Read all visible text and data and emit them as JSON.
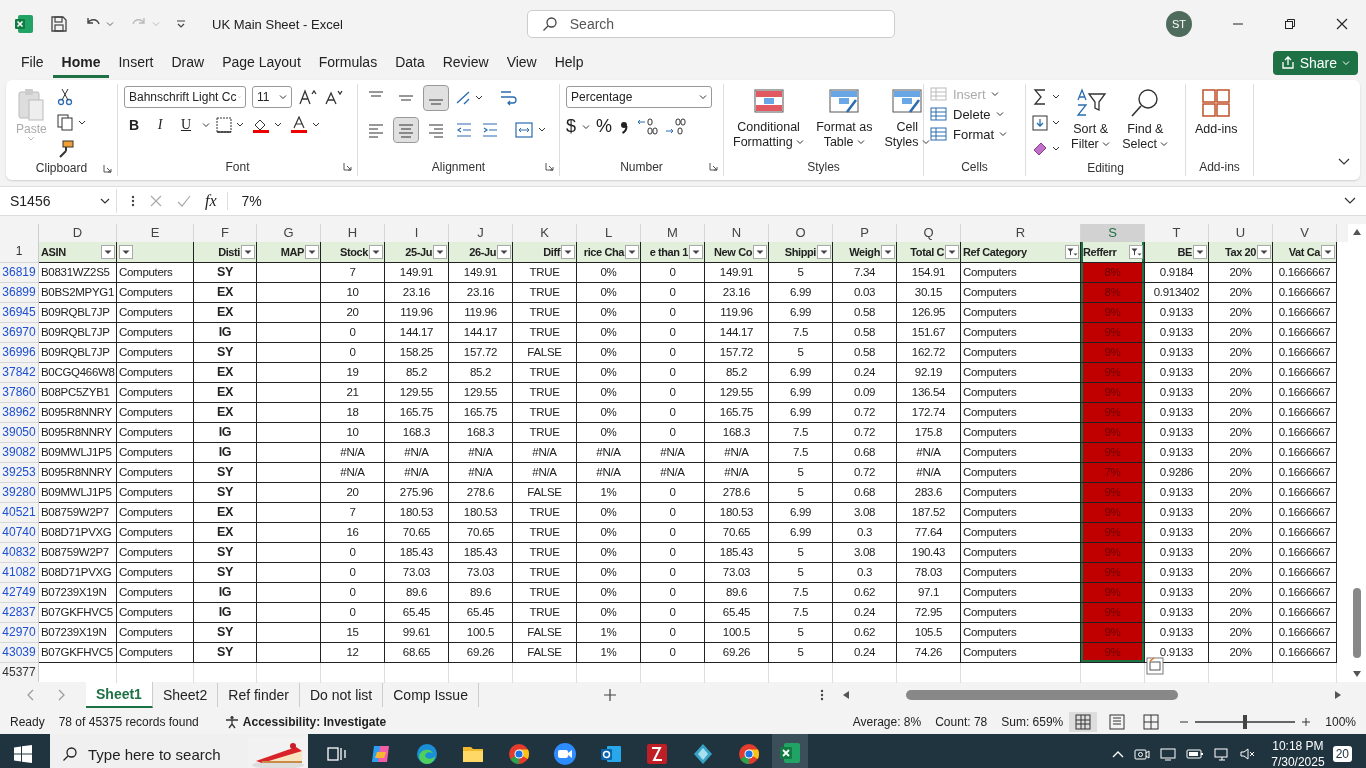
{
  "titlebar": {
    "file_name": "UK Main Sheet - Excel",
    "search_placeholder": "Search",
    "user_initials": "ST"
  },
  "menu": [
    {
      "label": "File",
      "selected": false
    },
    {
      "label": "Home",
      "selected": true
    },
    {
      "label": "Insert",
      "selected": false
    },
    {
      "label": "Draw",
      "selected": false
    },
    {
      "label": "Page Layout",
      "selected": false
    },
    {
      "label": "Formulas",
      "selected": false
    },
    {
      "label": "Data",
      "selected": false
    },
    {
      "label": "Review",
      "selected": false
    },
    {
      "label": "View",
      "selected": false
    },
    {
      "label": "Help",
      "selected": false
    }
  ],
  "share": "Share",
  "ribbon": {
    "clipboard": {
      "paste": "Paste",
      "label": "Clipboard"
    },
    "font": {
      "family": "Bahnschrift Light Cc",
      "size": "11",
      "bold": "B",
      "italic": "I",
      "underline": "U",
      "label": "Font"
    },
    "alignment": {
      "vertical": [
        {
          "selected": false
        },
        {
          "selected": false
        },
        {
          "selected": true
        }
      ],
      "horizontal": [
        {
          "selected": false
        },
        {
          "selected": true
        },
        {
          "selected": false
        }
      ],
      "label": "Alignment"
    },
    "number": {
      "format": "Percentage",
      "currency": "$",
      "percent": "%",
      "label": "Number"
    },
    "styles": {
      "items": [
        {
          "line1": "Conditional",
          "line2": "Formatting"
        },
        {
          "line1": "Format as",
          "line2": "Table"
        },
        {
          "line1": "Cell",
          "line2": "Styles"
        }
      ],
      "label": "Styles"
    },
    "cells": {
      "items": [
        {
          "label": "Insert",
          "disabled": true
        },
        {
          "label": "Delete",
          "disabled": false
        },
        {
          "label": "Format",
          "disabled": false
        }
      ],
      "label": "Cells"
    },
    "editing": {
      "items": [
        {
          "line1": "Sort &",
          "line2": "Filter"
        },
        {
          "line1": "Find &",
          "line2": "Select"
        }
      ],
      "label": "Editing"
    },
    "addins": {
      "button": "Add-ins",
      "label": "Add-ins"
    }
  },
  "formula_bar": {
    "name_box": "S1456",
    "function_label": "fx",
    "formula": "7%"
  },
  "columns": [
    {
      "letter": "D",
      "header": "ASIN",
      "kind": "text",
      "filtered": false,
      "selected": false
    },
    {
      "letter": "E",
      "kind": "text",
      "filtered": false,
      "selected": false
    },
    {
      "letter": "F",
      "header": "Disti",
      "kind": "bold",
      "filtered": false,
      "selected": false
    },
    {
      "letter": "G",
      "header": "MAP",
      "kind": "empty",
      "filtered": false,
      "selected": false
    },
    {
      "letter": "H",
      "header": "Stock",
      "kind": "number",
      "filtered": false,
      "selected": false
    },
    {
      "letter": "I",
      "header": "25-Ju",
      "kind": "number",
      "filtered": false,
      "selected": false
    },
    {
      "letter": "J",
      "header": "26-Ju",
      "kind": "number",
      "filtered": false,
      "selected": false
    },
    {
      "letter": "K",
      "header": "Diff",
      "kind": "number",
      "filtered": false,
      "selected": false
    },
    {
      "letter": "L",
      "header": "rice Cha",
      "kind": "number",
      "filtered": false,
      "selected": false
    },
    {
      "letter": "M",
      "header": "e than 1",
      "kind": "number",
      "filtered": false,
      "selected": false
    },
    {
      "letter": "N",
      "header": "New Co",
      "kind": "number",
      "filtered": false,
      "selected": false
    },
    {
      "letter": "O",
      "header": "Shippi",
      "kind": "number",
      "filtered": false,
      "selected": false
    },
    {
      "letter": "P",
      "header": "Weigh",
      "kind": "number",
      "filtered": false,
      "selected": false
    },
    {
      "letter": "Q",
      "header": "Total C",
      "kind": "number",
      "filtered": false,
      "selected": false
    },
    {
      "letter": "R",
      "header": "Ref Category",
      "kind": "text",
      "filtered": true,
      "selected": false
    },
    {
      "letter": "S",
      "header": "Refferr",
      "kind": "highlight",
      "filtered": true,
      "selected": true
    },
    {
      "letter": "T",
      "header": "BE",
      "kind": "number",
      "filtered": false,
      "selected": false
    },
    {
      "letter": "U",
      "header": "Tax 20",
      "kind": "number",
      "filtered": false,
      "selected": false
    },
    {
      "letter": "V",
      "header": "Vat Ca",
      "kind": "number",
      "filtered": false,
      "selected": false
    }
  ],
  "header_row_number": "1",
  "rows": [
    {
      "num": "36819",
      "cells": [
        "B0831WZ2S5",
        "Computers",
        "SY",
        "7",
        "149.91",
        "149.91",
        "TRUE",
        "0%",
        "0",
        "149.91",
        "5",
        "7.34",
        "154.91",
        "Computers",
        "8%",
        "0.9184",
        "20%",
        "0.1666667"
      ]
    },
    {
      "num": "36899",
      "cells": [
        "B0BS2MPYG1",
        "Computers",
        "EX",
        "10",
        "23.16",
        "23.16",
        "TRUE",
        "0%",
        "0",
        "23.16",
        "6.99",
        "0.03",
        "30.15",
        "Computers",
        "8%",
        "0.913402",
        "20%",
        "0.1666667"
      ]
    },
    {
      "num": "36945",
      "cells": [
        "B09RQBL7JP",
        "Computers",
        "EX",
        "20",
        "119.96",
        "119.96",
        "TRUE",
        "0%",
        "0",
        "119.96",
        "6.99",
        "0.58",
        "126.95",
        "Computers",
        "9%",
        "0.9133",
        "20%",
        "0.1666667"
      ]
    },
    {
      "num": "36970",
      "cells": [
        "B09RQBL7JP",
        "Computers",
        "IG",
        "0",
        "144.17",
        "144.17",
        "TRUE",
        "0%",
        "0",
        "144.17",
        "7.5",
        "0.58",
        "151.67",
        "Computers",
        "9%",
        "0.9133",
        "20%",
        "0.1666667"
      ]
    },
    {
      "num": "36996",
      "cells": [
        "B09RQBL7JP",
        "Computers",
        "SY",
        "0",
        "158.25",
        "157.72",
        "FALSE",
        "0%",
        "0",
        "157.72",
        "5",
        "0.58",
        "162.72",
        "Computers",
        "9%",
        "0.9133",
        "20%",
        "0.1666667"
      ]
    },
    {
      "num": "37842",
      "cells": [
        "B0CGQ466W8",
        "Computers",
        "EX",
        "19",
        "85.2",
        "85.2",
        "TRUE",
        "0%",
        "0",
        "85.2",
        "6.99",
        "0.24",
        "92.19",
        "Computers",
        "9%",
        "0.9133",
        "20%",
        "0.1666667"
      ]
    },
    {
      "num": "37860",
      "cells": [
        "B08PC5ZYB1",
        "Computers",
        "EX",
        "21",
        "129.55",
        "129.55",
        "TRUE",
        "0%",
        "0",
        "129.55",
        "6.99",
        "0.09",
        "136.54",
        "Computers",
        "9%",
        "0.9133",
        "20%",
        "0.1666667"
      ]
    },
    {
      "num": "38962",
      "cells": [
        "B095R8NNRY",
        "Computers",
        "EX",
        "18",
        "165.75",
        "165.75",
        "TRUE",
        "0%",
        "0",
        "165.75",
        "6.99",
        "0.72",
        "172.74",
        "Computers",
        "9%",
        "0.9133",
        "20%",
        "0.1666667"
      ]
    },
    {
      "num": "39050",
      "cells": [
        "B095R8NNRY",
        "Computers",
        "IG",
        "10",
        "168.3",
        "168.3",
        "TRUE",
        "0%",
        "0",
        "168.3",
        "7.5",
        "0.72",
        "175.8",
        "Computers",
        "9%",
        "0.9133",
        "20%",
        "0.1666667"
      ]
    },
    {
      "num": "39082",
      "cells": [
        "B09MWLJ1P5",
        "Computers",
        "IG",
        "#N/A",
        "#N/A",
        "#N/A",
        "#N/A",
        "#N/A",
        "#N/A",
        "#N/A",
        "7.5",
        "0.68",
        "#N/A",
        "Computers",
        "9%",
        "0.9133",
        "20%",
        "0.1666667"
      ]
    },
    {
      "num": "39253",
      "cells": [
        "B095R8NNRY",
        "Computers",
        "SY",
        "#N/A",
        "#N/A",
        "#N/A",
        "#N/A",
        "#N/A",
        "#N/A",
        "#N/A",
        "5",
        "0.72",
        "#N/A",
        "Computers",
        "7%",
        "0.9286",
        "20%",
        "0.1666667"
      ]
    },
    {
      "num": "39280",
      "cells": [
        "B09MWLJ1P5",
        "Computers",
        "SY",
        "20",
        "275.96",
        "278.6",
        "FALSE",
        "1%",
        "0",
        "278.6",
        "5",
        "0.68",
        "283.6",
        "Computers",
        "9%",
        "0.9133",
        "20%",
        "0.1666667"
      ]
    },
    {
      "num": "40521",
      "cells": [
        "B08759W2P7",
        "Computers",
        "EX",
        "7",
        "180.53",
        "180.53",
        "TRUE",
        "0%",
        "0",
        "180.53",
        "6.99",
        "3.08",
        "187.52",
        "Computers",
        "9%",
        "0.9133",
        "20%",
        "0.1666667"
      ]
    },
    {
      "num": "40740",
      "cells": [
        "B08D71PVXG",
        "Computers",
        "EX",
        "16",
        "70.65",
        "70.65",
        "TRUE",
        "0%",
        "0",
        "70.65",
        "6.99",
        "0.3",
        "77.64",
        "Computers",
        "9%",
        "0.9133",
        "20%",
        "0.1666667"
      ]
    },
    {
      "num": "40832",
      "cells": [
        "B08759W2P7",
        "Computers",
        "SY",
        "0",
        "185.43",
        "185.43",
        "TRUE",
        "0%",
        "0",
        "185.43",
        "5",
        "3.08",
        "190.43",
        "Computers",
        "9%",
        "0.9133",
        "20%",
        "0.1666667"
      ]
    },
    {
      "num": "41082",
      "cells": [
        "B08D71PVXG",
        "Computers",
        "SY",
        "0",
        "73.03",
        "73.03",
        "TRUE",
        "0%",
        "0",
        "73.03",
        "5",
        "0.3",
        "78.03",
        "Computers",
        "9%",
        "0.9133",
        "20%",
        "0.1666667"
      ]
    },
    {
      "num": "42749",
      "cells": [
        "B07239X19N",
        "Computers",
        "IG",
        "0",
        "89.6",
        "89.6",
        "TRUE",
        "0%",
        "0",
        "89.6",
        "7.5",
        "0.62",
        "97.1",
        "Computers",
        "9%",
        "0.9133",
        "20%",
        "0.1666667"
      ]
    },
    {
      "num": "42837",
      "cells": [
        "B07GKFHVC5",
        "Computers",
        "IG",
        "0",
        "65.45",
        "65.45",
        "TRUE",
        "0%",
        "0",
        "65.45",
        "7.5",
        "0.24",
        "72.95",
        "Computers",
        "9%",
        "0.9133",
        "20%",
        "0.1666667"
      ]
    },
    {
      "num": "42970",
      "cells": [
        "B07239X19N",
        "Computers",
        "SY",
        "15",
        "99.61",
        "100.5",
        "FALSE",
        "1%",
        "0",
        "100.5",
        "5",
        "0.62",
        "105.5",
        "Computers",
        "9%",
        "0.9133",
        "20%",
        "0.1666667"
      ]
    },
    {
      "num": "43039",
      "cells": [
        "B07GKFHVC5",
        "Computers",
        "SY",
        "12",
        "68.65",
        "69.26",
        "FALSE",
        "1%",
        "0",
        "69.26",
        "5",
        "0.24",
        "74.26",
        "Computers",
        "9%",
        "0.9133",
        "20%",
        "0.1666667"
      ]
    }
  ],
  "last_row_number": "45377",
  "sheets": [
    {
      "label": "Sheet1",
      "selected": true
    },
    {
      "label": "Sheet2",
      "selected": false
    },
    {
      "label": "Ref finder",
      "selected": false
    },
    {
      "label": "Do not list",
      "selected": false
    },
    {
      "label": "Comp Issue",
      "selected": false
    }
  ],
  "status": {
    "mode": "Ready",
    "records": "78 of 45375 records found",
    "accessibility": "Accessibility: Investigate",
    "average": "Average: 8%",
    "count": "Count: 78",
    "sum": "Sum: 659%",
    "views": [
      {
        "selected": true
      },
      {
        "selected": false
      },
      {
        "selected": false
      }
    ],
    "zoom": {
      "level": 0.5
    },
    "zoom_label": "100%"
  },
  "taskbar": {
    "search_placeholder": "Type here to search",
    "time": "10:18 PM",
    "date": "7/30/2025",
    "notifications": "20"
  }
}
